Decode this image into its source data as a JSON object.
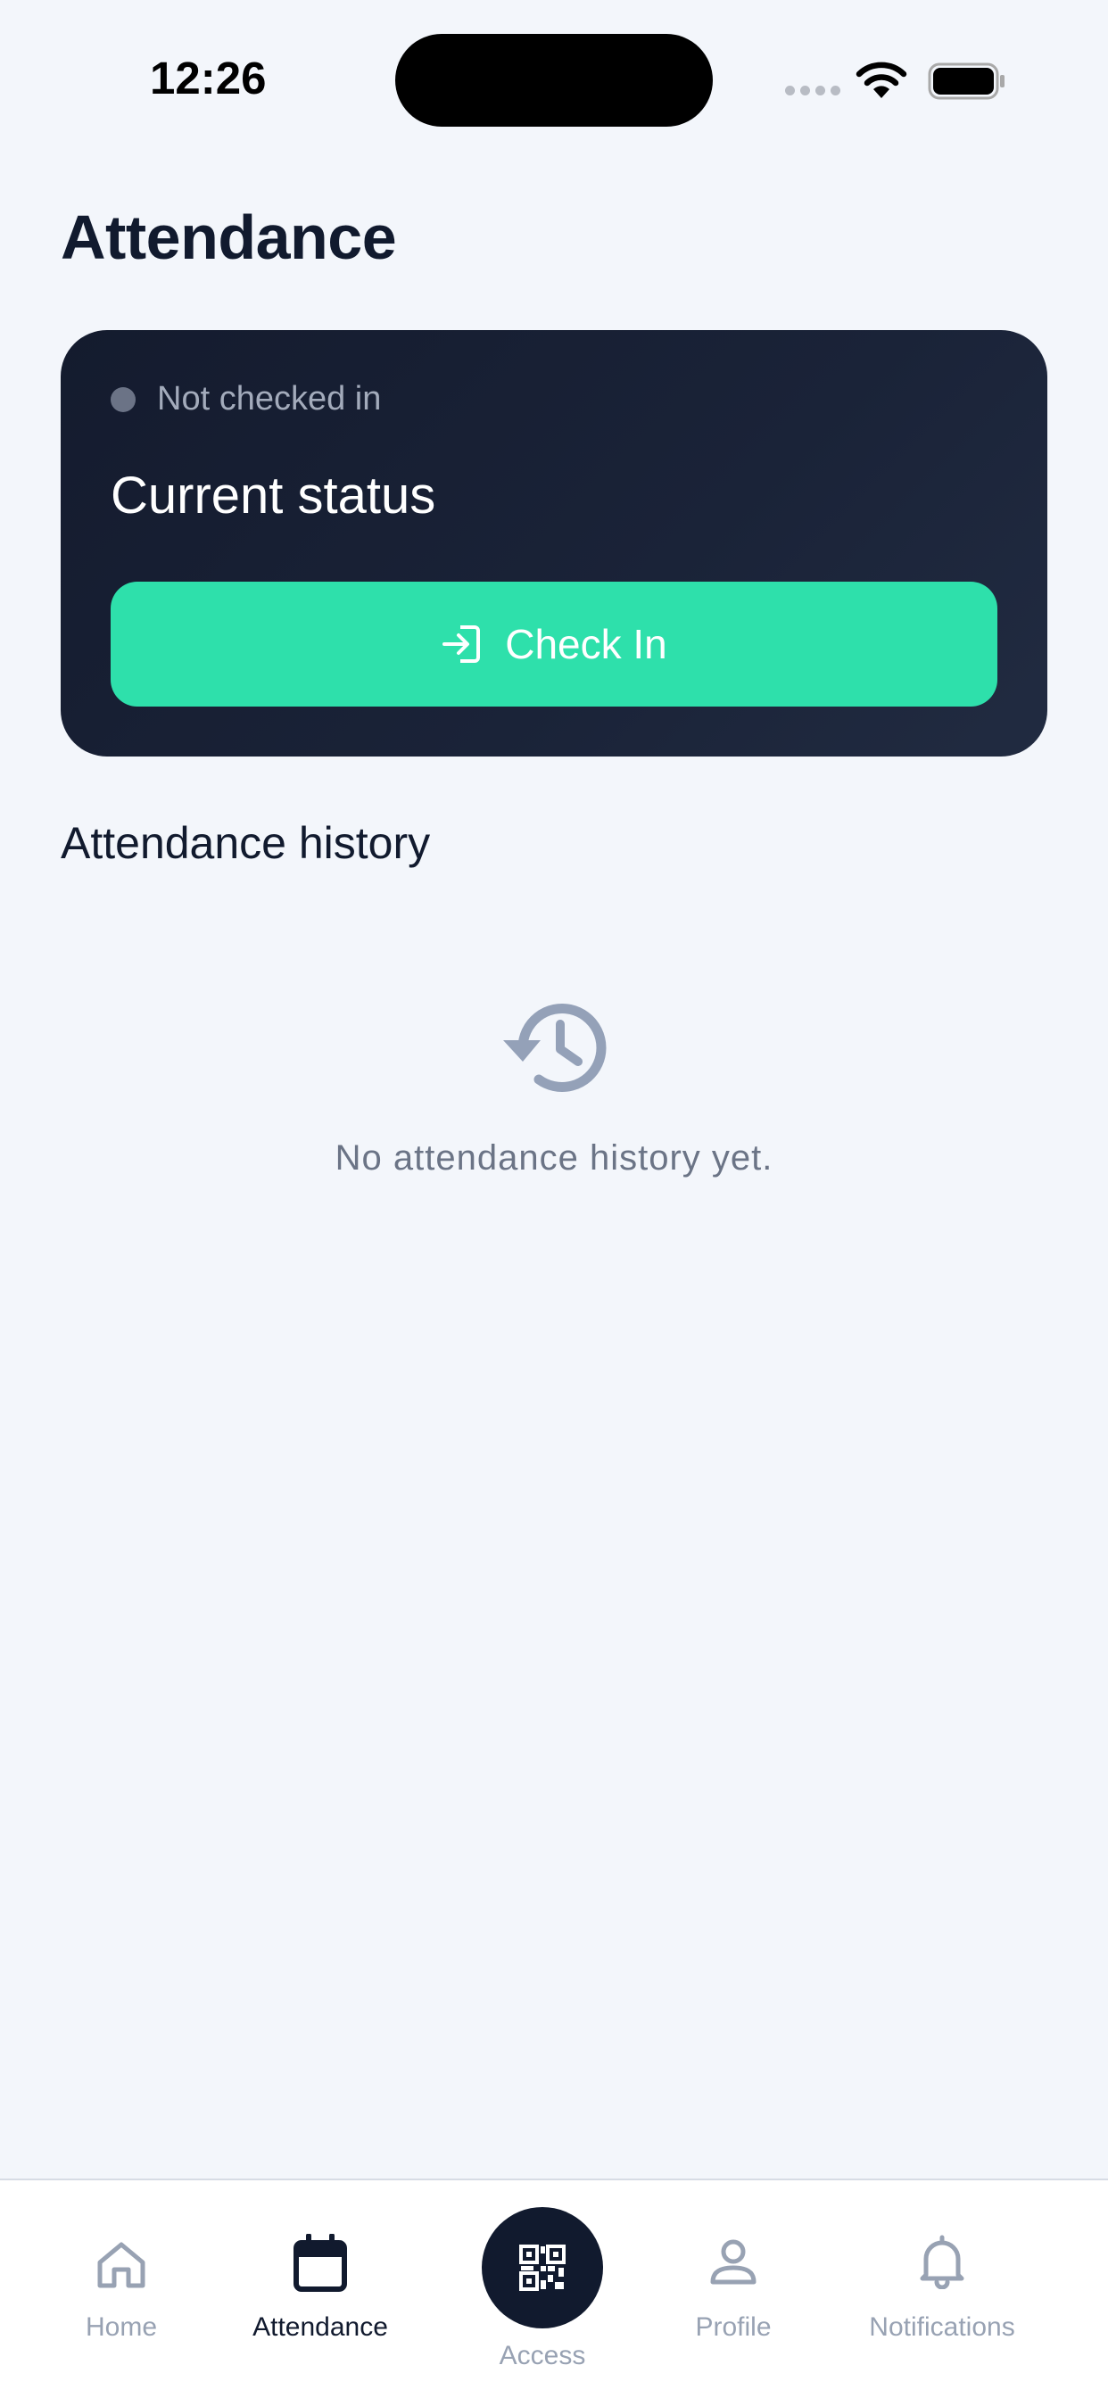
{
  "status_bar": {
    "time": "12:26"
  },
  "page": {
    "title": "Attendance"
  },
  "status_card": {
    "status_text": "Not checked in",
    "heading": "Current status",
    "button_label": "Check In"
  },
  "history": {
    "title": "Attendance history",
    "empty_text": "No attendance history yet."
  },
  "tab_bar": {
    "tabs": [
      {
        "label": "Home",
        "icon": "home-icon",
        "active": false
      },
      {
        "label": "Attendance",
        "icon": "calendar-icon",
        "active": true
      },
      {
        "label": "Access",
        "icon": "qr-code-icon",
        "active": false
      },
      {
        "label": "Profile",
        "icon": "person-icon",
        "active": false
      },
      {
        "label": "Notifications",
        "icon": "bell-icon",
        "active": false
      }
    ]
  },
  "colors": {
    "background": "#f3f6fb",
    "card": "#161e31",
    "accent": "#2ee0ab",
    "inactive_tab": "#98a2b3",
    "active_tab": "#111a2e"
  }
}
